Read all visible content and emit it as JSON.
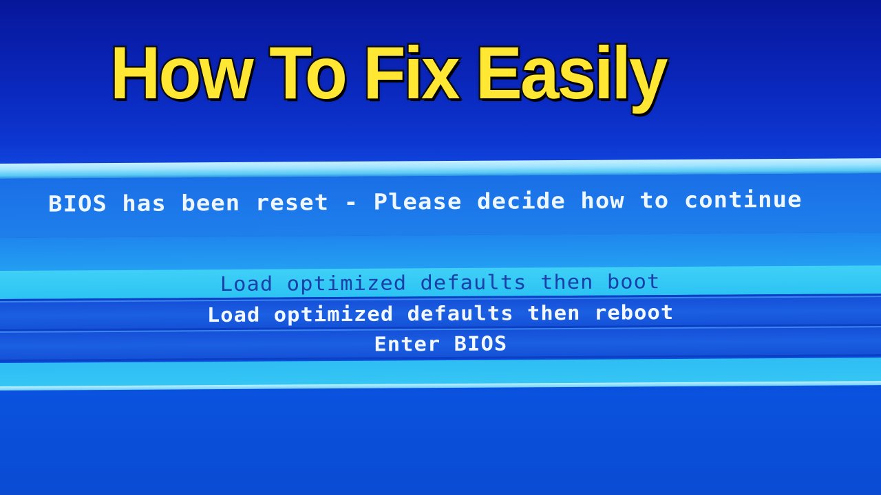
{
  "thumbnail": {
    "headline": "How To Fix Easily",
    "headline_color": "#ffe733"
  },
  "bios_dialog": {
    "title": "BIOS has been reset - Please decide how to continue",
    "options": [
      {
        "label": "Load optimized defaults then boot",
        "selected": true
      },
      {
        "label": "Load optimized defaults then reboot",
        "selected": false
      },
      {
        "label": "Enter BIOS",
        "selected": false
      }
    ],
    "colors": {
      "background": "#0a4fd8",
      "selected_bar": "#33c8f5",
      "selected_text": "#1a3fa8",
      "normal_text": "#f3f8ff"
    }
  }
}
